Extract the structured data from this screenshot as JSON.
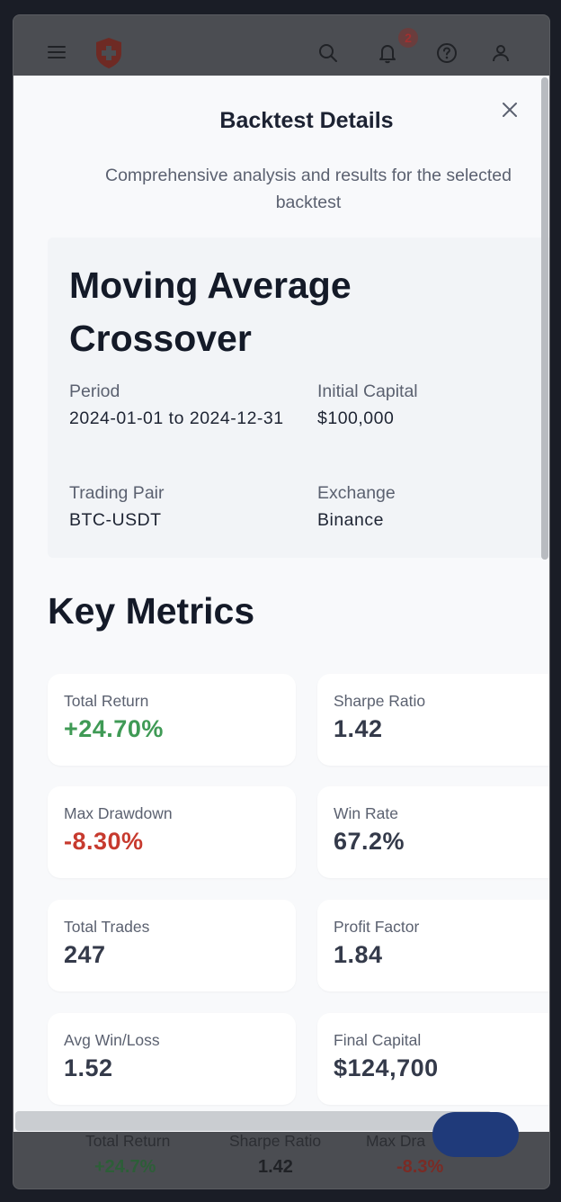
{
  "appbar": {
    "icons": [
      "menu-icon",
      "shield-logo-icon",
      "search-icon",
      "bell-icon",
      "help-icon",
      "user-icon"
    ],
    "notification_count": "2"
  },
  "modal": {
    "title": "Backtest Details",
    "description": "Comprehensive analysis and results for the selected backtest",
    "close_icon": "close-icon"
  },
  "strategy": {
    "name": "Moving Average Crossover",
    "period_label": "Period",
    "period_value": "2024-01-01 to 2024-12-31",
    "capital_label": "Initial Capital",
    "capital_value": "$100,000",
    "pair_label": "Trading Pair",
    "pair_value": "BTC-USDT",
    "exchange_label": "Exchange",
    "exchange_value": "Binance"
  },
  "metrics_section": {
    "title": "Key Metrics",
    "items": [
      {
        "label": "Total Return",
        "value": "+24.70%"
      },
      {
        "label": "Sharpe Ratio",
        "value": "1.42"
      },
      {
        "label": "Max Drawdown",
        "value": "-8.30%"
      },
      {
        "label": "Win Rate",
        "value": "67.2%"
      },
      {
        "label": "Total Trades",
        "value": "247"
      },
      {
        "label": "Profit Factor",
        "value": "1.84"
      },
      {
        "label": "Avg Win/Loss",
        "value": "1.52"
      },
      {
        "label": "Final Capital",
        "value": "$124,700"
      }
    ]
  },
  "background_summary": {
    "items": [
      {
        "label": "Total Return",
        "value": "+24.7%"
      },
      {
        "label": "Sharpe Ratio",
        "value": "1.42"
      },
      {
        "label": "Max Dra",
        "value": "-8.3%"
      }
    ]
  },
  "colors": {
    "positive": "#3f9a55",
    "negative": "#c73a2e",
    "overlay": "#4b4d52"
  }
}
